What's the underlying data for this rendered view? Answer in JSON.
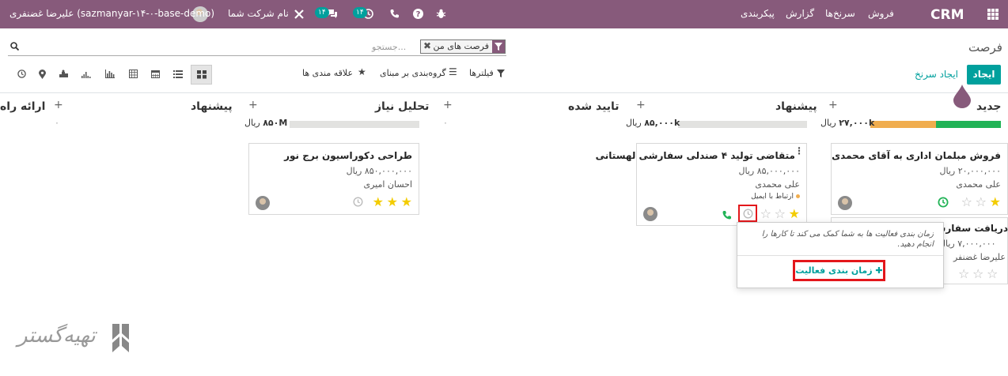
{
  "topbar": {
    "app_name": "CRM",
    "menu": [
      "فروش",
      "سرنخ‌ها",
      "گزارش",
      "پیکربندی"
    ],
    "company": "نام شرکت شما",
    "user": "علیرضا غضنفری (sazmanyar-۱۴-۰-base-demo)",
    "chat_count": "۱۴",
    "activity_count": "۱۴"
  },
  "control_panel": {
    "breadcrumb": "فرصت",
    "create_label": "ایجاد",
    "generate_leads_label": "ایجاد سرنخ",
    "facet_label": "فرصت های من",
    "search_placeholder": "جستجو...",
    "filters_label": "فیلترها",
    "groupby_label": "گروه‌بندی بر مبنای",
    "favorites_label": "علاقه مندی ها"
  },
  "columns": [
    {
      "title": "جدید",
      "amount": "۲۷,۰۰۰k",
      "currency": "ریال"
    },
    {
      "title": "پیشنهاد",
      "amount": "۸۵,۰۰۰k",
      "currency": "ریال"
    },
    {
      "title": "تایید شده",
      "amount": "۰",
      "currency": ""
    },
    {
      "title": "تحلیل نیاز",
      "amount": "۸۵۰M",
      "currency": "ریال"
    },
    {
      "title": "پیشنهاد",
      "amount": "۰",
      "currency": ""
    },
    {
      "title": "ارائه راه",
      "amount": "",
      "currency": ""
    }
  ],
  "cards": {
    "new_1": {
      "name": "فروش مبلمان اداری به آقای محمدی",
      "revenue": "۲۰,۰۰۰,۰۰۰ ریال",
      "contact": "علی محمدی"
    },
    "new_2": {
      "name": "دریافت سفارش",
      "revenue": "۷,۰۰۰,۰۰۰ ریال",
      "contact": "علیرضا غضنفر"
    },
    "proposal_1": {
      "name": "متقاضی تولید ۴ صندلی سفارشی لهستانی",
      "revenue": "۸۵,۰۰۰,۰۰۰ ریال",
      "contact": "علی محمدی",
      "tag": "ارتباط با ایمیل"
    },
    "analysis_1": {
      "name": "طراحی دکوراسیون برج نور",
      "revenue": "۸۵۰,۰۰۰,۰۰۰ ریال",
      "contact": "احسان امیری"
    }
  },
  "popover": {
    "message": "زمان بندی فعالیت ها به شما کمک می کند تا کارها را انجام دهید.",
    "button_label": "زمان بندی فعالیت"
  },
  "watermark": "تهیه‌گستر",
  "colors": {
    "brand": "#875a7b",
    "accent": "#00a09d",
    "highlight": "#e3171b",
    "progress_green": "#21b356",
    "progress_orange": "#f0ad4e",
    "star": "#f3cc00"
  },
  "icons": [
    "apps-icon",
    "bug-icon",
    "help-icon",
    "phone-icon",
    "clock-icon",
    "chat-icon",
    "tools-icon",
    "search-icon",
    "filter-icon",
    "kanban-icon",
    "list-icon",
    "calendar-icon",
    "pivot-icon",
    "graph-icon",
    "cohort-icon",
    "map-icon",
    "activity-icon"
  ]
}
